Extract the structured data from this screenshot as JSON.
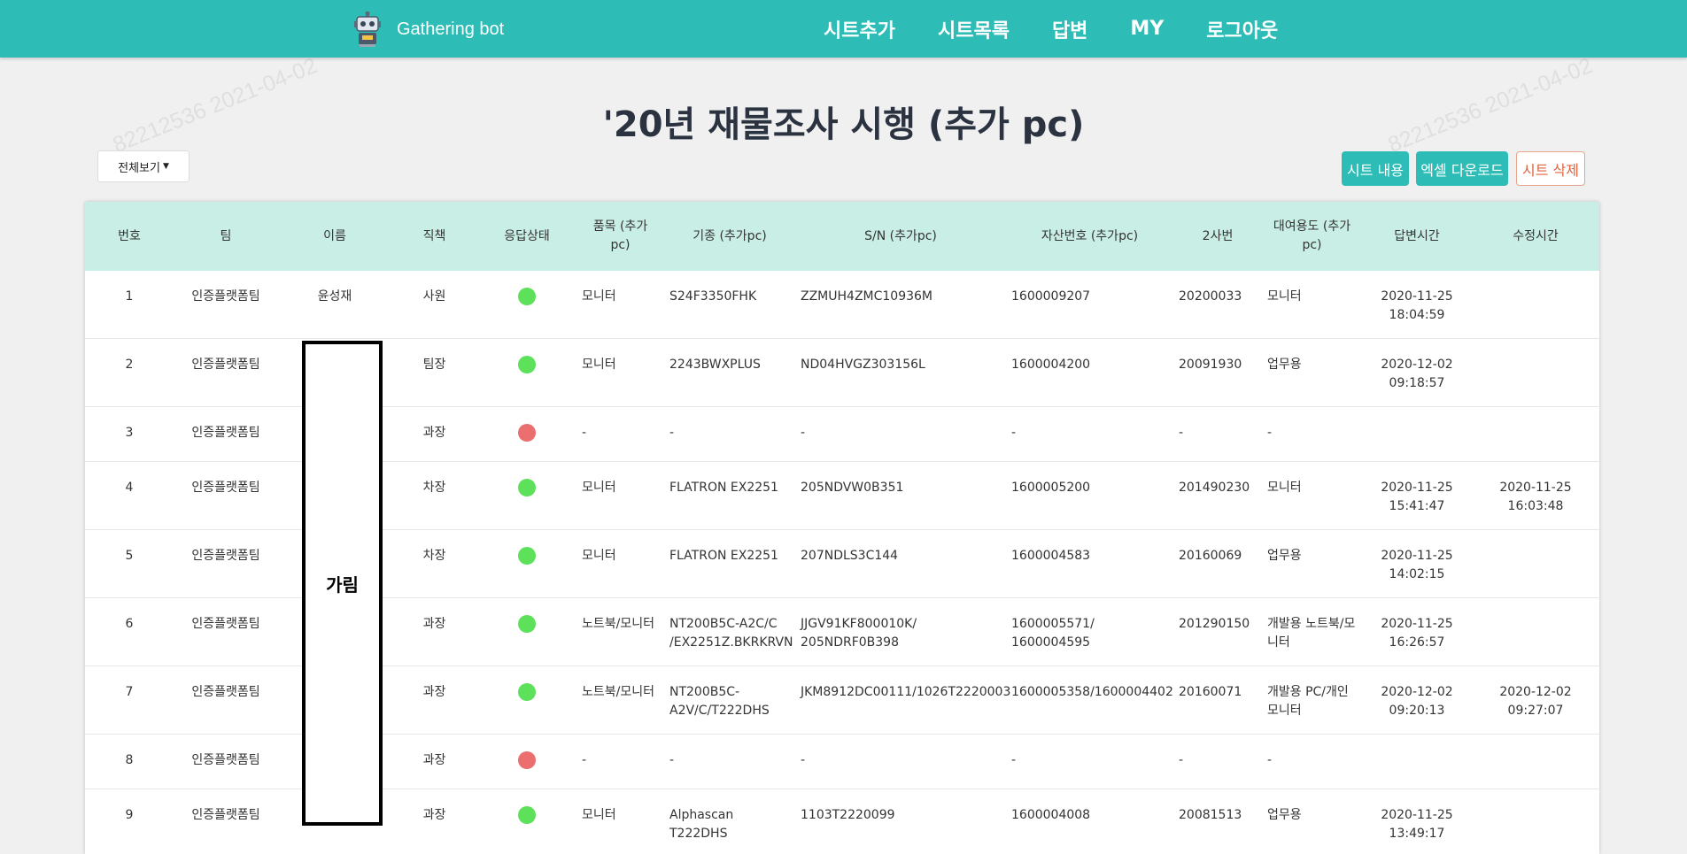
{
  "app": {
    "brand": "Gathering bot",
    "nav": [
      "시트추가",
      "시트목록",
      "답변",
      "MY",
      "로그아웃"
    ]
  },
  "page": {
    "title": "'20년 재물조사 시행 (추가 pc)",
    "filter_dropdown": "전체보기",
    "buttons": {
      "sheet_content": "시트 내용",
      "excel_download": "엑셀 다운로드",
      "sheet_delete": "시트 삭제"
    },
    "watermark": "82212536  2021-04-02",
    "masked_label": "가림"
  },
  "table": {
    "headers": [
      "번호",
      "팀",
      "이름",
      "직책",
      "응답상태",
      "품목 (추가 pc)",
      "기종 (추가pc)",
      "S/N (추가pc)",
      "자산번호 (추가pc)",
      "2사번",
      "대여용도 (추가pc)",
      "답변시간",
      "수정시간"
    ],
    "rows": [
      {
        "no": "1",
        "team": "인증플랫폼팀",
        "name": "윤성재",
        "position": "사원",
        "status": "green",
        "item": "모니터",
        "model": "S24F3350FHK",
        "sn": "ZZMUH4ZMC10936M",
        "asset": "1600009207",
        "emp2": "20200033",
        "purpose": "모니터",
        "answered": "2020-11-25 18:04:59",
        "modified": ""
      },
      {
        "no": "2",
        "team": "인증플랫폼팀",
        "name": "",
        "position": "팀장",
        "status": "green",
        "item": "모니터",
        "model": "2243BWXPLUS",
        "sn": "ND04HVGZ303156L",
        "asset": "1600004200",
        "emp2": "20091930",
        "purpose": "업무용",
        "answered": "2020-12-02 09:18:57",
        "modified": ""
      },
      {
        "no": "3",
        "team": "인증플랫폼팀",
        "name": "",
        "position": "과장",
        "status": "red",
        "item": "-",
        "model": "-",
        "sn": "-",
        "asset": "-",
        "emp2": "-",
        "purpose": "-",
        "answered": "",
        "modified": ""
      },
      {
        "no": "4",
        "team": "인증플랫폼팀",
        "name": "",
        "position": "차장",
        "status": "green",
        "item": "모니터",
        "model": "FLATRON EX2251",
        "sn": "205NDVW0B351",
        "asset": "1600005200",
        "emp2": "201490230",
        "purpose": "모니터",
        "answered": "2020-11-25 15:41:47",
        "modified": "2020-11-25 16:03:48"
      },
      {
        "no": "5",
        "team": "인증플랫폼팀",
        "name": "",
        "position": "차장",
        "status": "green",
        "item": "모니터",
        "model": "FLATRON EX2251",
        "sn": "207NDLS3C144",
        "asset": "1600004583",
        "emp2": "20160069",
        "purpose": "업무용",
        "answered": "2020-11-25 14:02:15",
        "modified": ""
      },
      {
        "no": "6",
        "team": "인증플랫폼팀",
        "name": "",
        "position": "과장",
        "status": "green",
        "item": "노트북/모니터",
        "model": "NT200B5C-A2C/C /EX2251Z.BKRKRVN",
        "sn": "JJGV91KF800010K/ 205NDRF0B398",
        "asset": "1600005571/ 1600004595",
        "emp2": "201290150",
        "purpose": "개발용 노트북/모니터",
        "answered": "2020-11-25 16:26:57",
        "modified": ""
      },
      {
        "no": "7",
        "team": "인증플랫폼팀",
        "name": "",
        "position": "과장",
        "status": "green",
        "item": "노트북/모니터",
        "model": "NT200B5C-A2V/C/T222DHS",
        "sn": "JKM8912DC00111/1026T2220003",
        "asset": "1600005358/1600004402",
        "emp2": "20160071",
        "purpose": "개발용 PC/개인모니터",
        "answered": "2020-12-02 09:20:13",
        "modified": "2020-12-02 09:27:07"
      },
      {
        "no": "8",
        "team": "인증플랫폼팀",
        "name": "",
        "position": "과장",
        "status": "red",
        "item": "-",
        "model": "-",
        "sn": "-",
        "asset": "-",
        "emp2": "-",
        "purpose": "-",
        "answered": "",
        "modified": ""
      },
      {
        "no": "9",
        "team": "인증플랫폼팀",
        "name": "",
        "position": "과장",
        "status": "green",
        "item": "모니터",
        "model": "Alphascan T222DHS",
        "sn": "1103T2220099",
        "asset": "1600004008",
        "emp2": "20081513",
        "purpose": "업무용",
        "answered": "2020-11-25 13:49:17",
        "modified": ""
      }
    ]
  },
  "colors": {
    "primary": "#2dbdb6",
    "header_bg": "#c9eee5",
    "status_green": "#5de05a",
    "status_red": "#eb6f6f",
    "danger": "#e0643f"
  }
}
